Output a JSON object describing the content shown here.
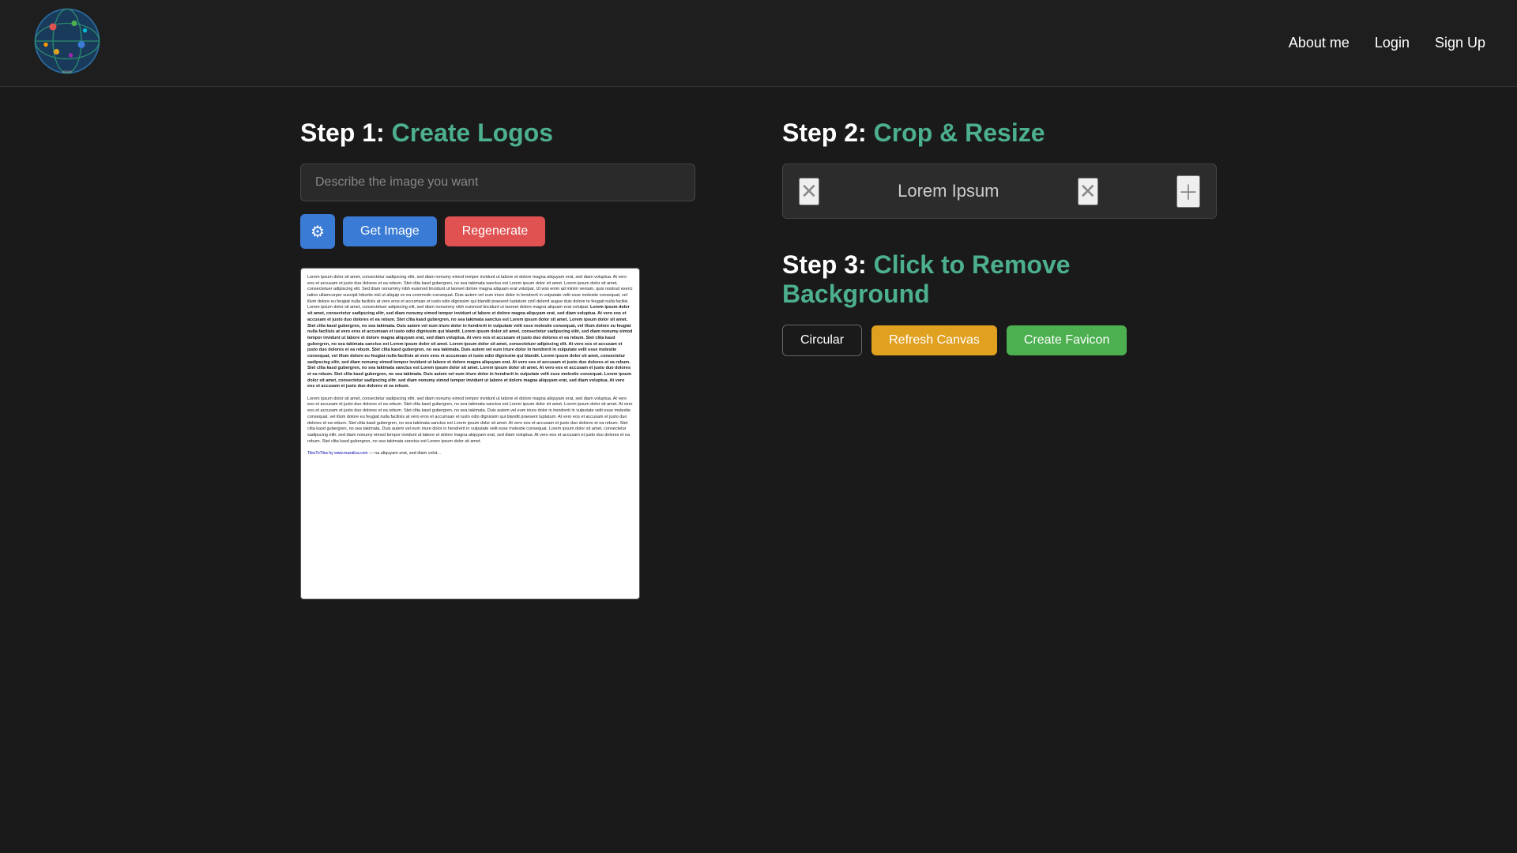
{
  "nav": {
    "logo_alt": "Globe Logo",
    "links": [
      {
        "id": "about-me",
        "label": "About me"
      },
      {
        "id": "login",
        "label": "Login"
      },
      {
        "id": "signup",
        "label": "Sign Up"
      }
    ]
  },
  "step1": {
    "heading_prefix": "Step 1: ",
    "heading_title": "Create Logos",
    "input_placeholder": "Describe the image you want",
    "input_value": "",
    "btn_get_image": "Get Image",
    "btn_regenerate": "Regenerate"
  },
  "step2": {
    "heading_prefix": "Step 2: ",
    "heading_title": "Crop & Resize",
    "crop_label": "Lorem Ipsum"
  },
  "step3": {
    "heading_prefix": "Step 3: ",
    "heading_title": "Click to Remove Background",
    "btn_circular": "Circular",
    "btn_refresh": "Refresh Canvas",
    "btn_create_favicon": "Create Favicon"
  },
  "lorem_ipsum": "Lorem ipsum dolor sit amet, consectetur sadipscing elitr, sed diam nonumy eimod tempor invidunt ut labore et dolore magna aliquyam erat, sed diam voluptua. At vero eos et accusam et justo duo dolores et ea rebum. Stet clita kasd gubergren, no sea takimata sanctus est Lorem ipsum dolor sit amet. Lorem ipsum dolor sit amet, consectetuer adipiscing elit. Sed diam nonummy nibh euismod tincidunt ut laoreet dolore magna aliquam erat volutpat. Ut wisi enim ad minim veniam, quis nostrud exerci tation ullamcorper suscipit lobortis nisl ut aliquip ex ea commodo consequat. Duis autem vel eum iriure dolor in hendrerit in vulputate velit esse molestie consequat, vel illum dolore eu feugiat nulla facilisis at vero eros et accumsan et iusto odio dignissim qui blandit praesent luptatum zzril delenit augue duis dolore te feugait nulla facilisi. Lorem ipsum dolor sit amet, consectetuer adipiscing elit, sed diam nonummy nibh euismod tincidunt ut laoreet dolore magna aliquam erat volutpat."
}
